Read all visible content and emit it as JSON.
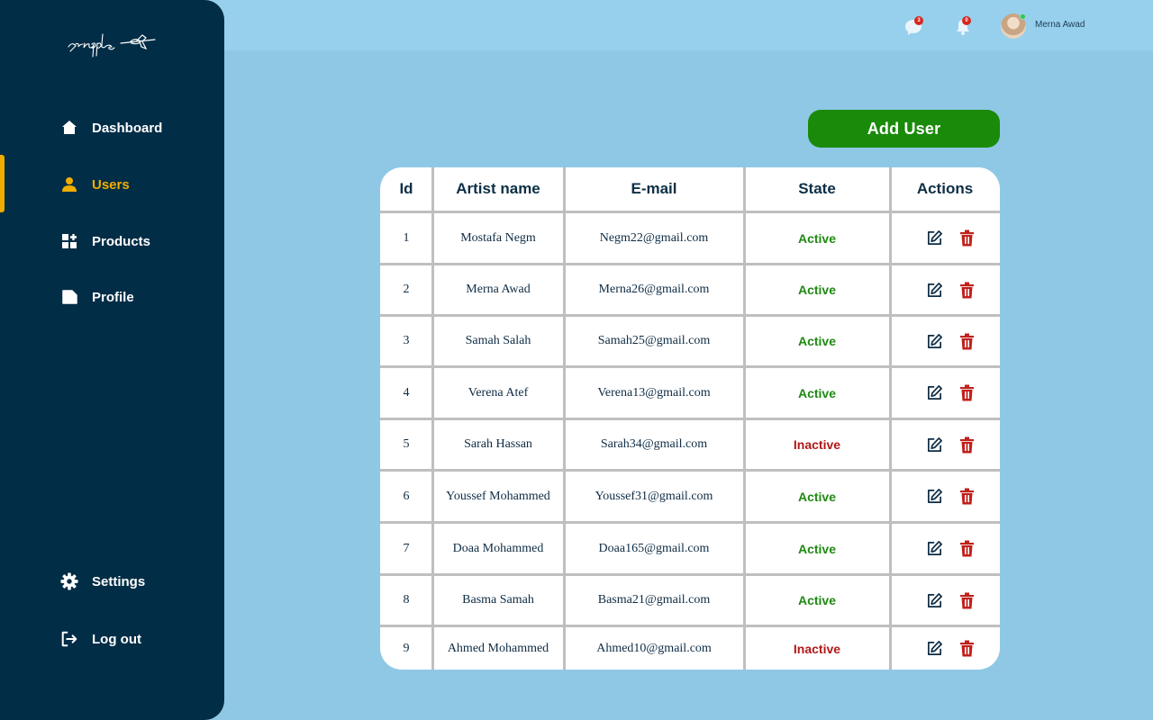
{
  "app": {
    "logo_text": "scripple"
  },
  "sidebar": {
    "items": [
      {
        "label": "Dashboard",
        "icon": "home-icon"
      },
      {
        "label": "Users",
        "icon": "user-icon",
        "active": true
      },
      {
        "label": "Products",
        "icon": "grid-plus-icon"
      },
      {
        "label": "Profile",
        "icon": "file-icon"
      }
    ],
    "bottom": [
      {
        "label": "Settings",
        "icon": "gear-icon"
      },
      {
        "label": "Log out",
        "icon": "logout-icon"
      }
    ]
  },
  "topbar": {
    "messages_count": "3",
    "notifications_count": "0",
    "user_name": "Merna Awad"
  },
  "main": {
    "add_button": "Add User",
    "table": {
      "headers": [
        "Id",
        "Artist name",
        "E-mail",
        "State",
        "Actions"
      ],
      "rows": [
        {
          "id": "1",
          "name": "Mostafa Negm",
          "email": "Negm22@gmail.com",
          "state": "Active"
        },
        {
          "id": "2",
          "name": "Merna Awad",
          "email": "Merna26@gmail.com",
          "state": "Active"
        },
        {
          "id": "3",
          "name": "Samah Salah",
          "email": "Samah25@gmail.com",
          "state": "Active"
        },
        {
          "id": "4",
          "name": "Verena Atef",
          "email": "Verena13@gmail.com",
          "state": "Active"
        },
        {
          "id": "5",
          "name": "Sarah Hassan",
          "email": "Sarah34@gmail.com",
          "state": "Inactive"
        },
        {
          "id": "6",
          "name": "Youssef Mohammed",
          "email": "Youssef31@gmail.com",
          "state": "Active"
        },
        {
          "id": "7",
          "name": "Doaa Mohammed",
          "email": "Doaa165@gmail.com",
          "state": "Active"
        },
        {
          "id": "8",
          "name": "Basma Samah",
          "email": "Basma21@gmail.com",
          "state": "Active"
        },
        {
          "id": "9",
          "name": "Ahmed Mohammed",
          "email": "Ahmed10@gmail.com",
          "state": "Inactive"
        }
      ]
    }
  },
  "colors": {
    "sidebar_bg": "#022d46",
    "page_bg": "#8fc8e5",
    "accent": "#f0ad00",
    "add_button": "#1a8a0b",
    "active_state": "#1f8a12",
    "inactive_state": "#b01818",
    "delete_icon": "#c0201b"
  }
}
